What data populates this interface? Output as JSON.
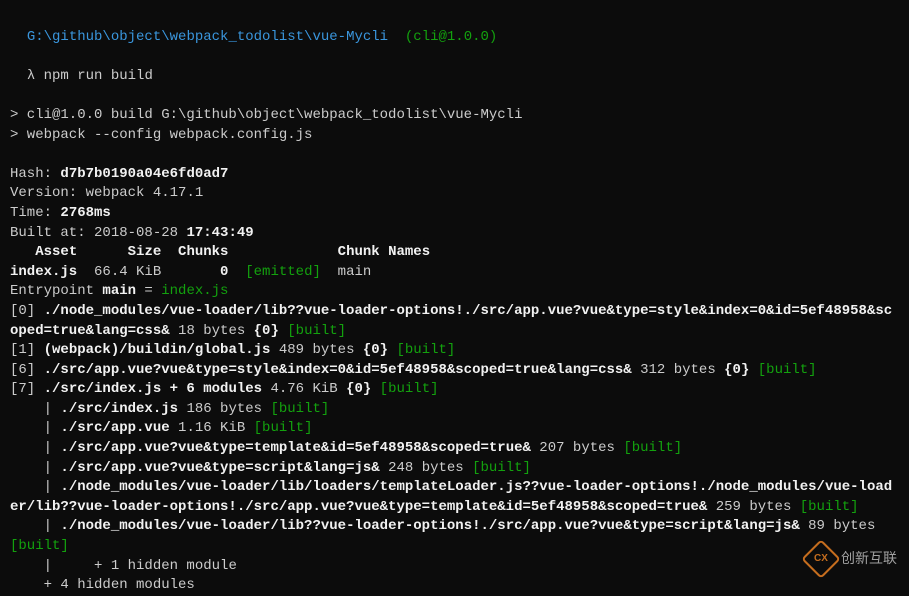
{
  "prompt": {
    "path": "G:\\github\\object\\webpack_todolist\\vue-Mycli",
    "pkg": "(cli@1.0.0)",
    "symbol": "λ",
    "cmd": "npm run build"
  },
  "run": {
    "line1": "> cli@1.0.0 build G:\\github\\object\\webpack_todolist\\vue-Mycli",
    "line2": "> webpack --config webpack.config.js"
  },
  "stats": {
    "hash_label": "Hash: ",
    "hash": "d7b7b0190a04e6fd0ad7",
    "version_label": "Version: ",
    "version": "webpack 4.17.1",
    "time_label": "Time: ",
    "time": "2768ms",
    "built_label": "Built at: ",
    "built_date": "2018-08-28 ",
    "built_time": "17:43:49"
  },
  "header": {
    "asset": "   Asset",
    "size": "      Size",
    "chunks": "  Chunks",
    "chunknames": "             Chunk Names"
  },
  "asset_row": {
    "name": "index.js",
    "size": "  66.4 KiB",
    "chunk": "       0",
    "emitted": "  [emitted]",
    "chunkname": "  main"
  },
  "entrypoint": {
    "prefix": "Entrypoint ",
    "name": "main",
    "eq": " = ",
    "file": "index.js"
  },
  "modules": {
    "m0_a": "[0] ",
    "m0_b": "./node_modules/vue-loader/lib??vue-loader-options!./src/app.vue?vue&type=style&index=0&id=5ef48958&scoped=true&lang=css&",
    "m0_c": " 18 bytes ",
    "m0_d": "{0}",
    "m0_e": " [built]",
    "m1_a": "[1] ",
    "m1_b": "(webpack)/buildin/global.js",
    "m1_c": " 489 bytes ",
    "m1_d": "{0}",
    "m1_e": " [built]",
    "m6_a": "[6] ",
    "m6_b": "./src/app.vue?vue&type=style&index=0&id=5ef48958&scoped=true&lang=css&",
    "m6_c": " 312 bytes ",
    "m6_d": "{0}",
    "m6_e": " [built]",
    "m7_a": "[7] ",
    "m7_b": "./src/index.js + 6 modules",
    "m7_c": " 4.76 KiB ",
    "m7_d": "{0}",
    "m7_e": " [built]",
    "sub1_p": "    | ",
    "sub1_f": "./src/index.js",
    "sub1_s": " 186 bytes ",
    "sub1_b": "[built]",
    "sub2_f": "./src/app.vue",
    "sub2_s": " 1.16 KiB ",
    "sub2_b": "[built]",
    "sub3_f": "./src/app.vue?vue&type=template&id=5ef48958&scoped=true&",
    "sub3_s": " 207 bytes ",
    "sub3_b": "[built]",
    "sub4_f": "./src/app.vue?vue&type=script&lang=js&",
    "sub4_s": " 248 bytes ",
    "sub4_b": "[built]",
    "sub5_f": "./node_modules/vue-loader/lib/loaders/templateLoader.js??vue-loader-options!./node_modules/vue-loader/lib??vue-loader-options!./src/app.vue?vue&type=template&id=5ef48958&scoped=true&",
    "sub5_s": " 259 bytes ",
    "sub5_b": "[built]",
    "sub6_f": "./node_modules/vue-loader/lib??vue-loader-options!./src/app.vue?vue&type=script&lang=js&",
    "sub6_s": " 89 bytes ",
    "sub6_b": "[built]",
    "hidden1": "    |     + 1 hidden module",
    "hidden2": "    + 4 hidden modules"
  },
  "watermark": {
    "text": "创新互联",
    "logo": "CX"
  }
}
